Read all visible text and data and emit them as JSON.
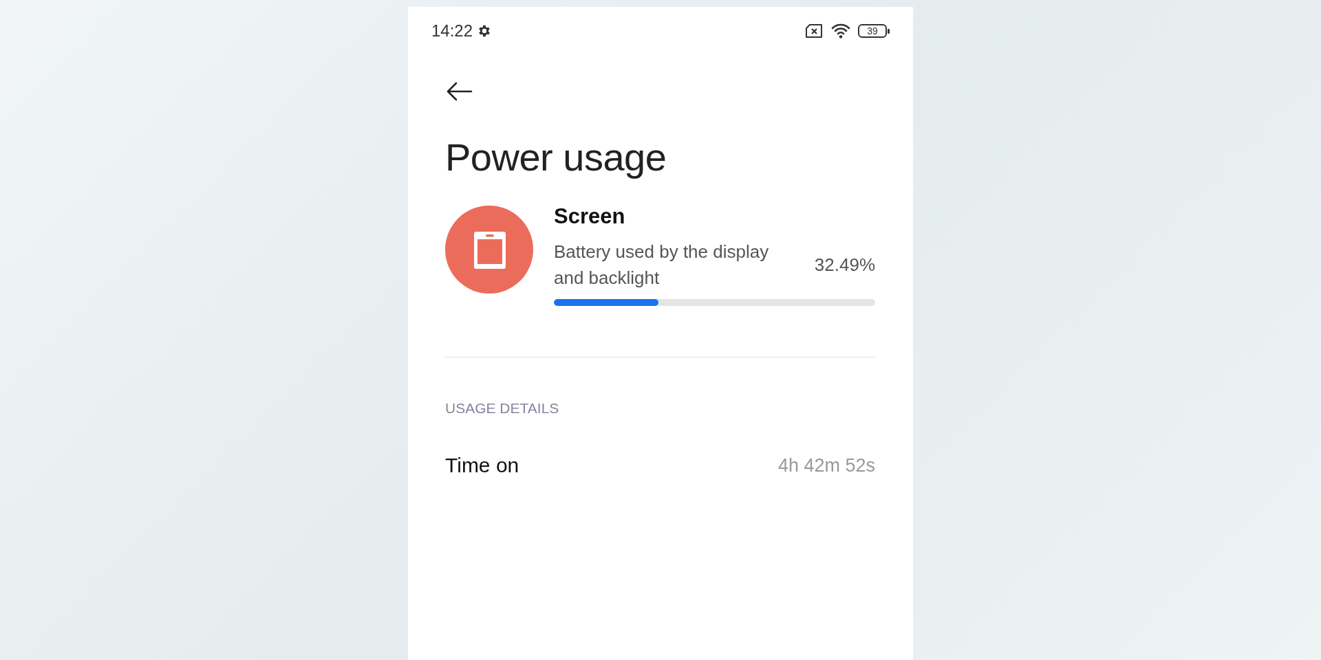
{
  "status_bar": {
    "time": "14:22",
    "battery": "39"
  },
  "title": "Power usage",
  "usage_item": {
    "name": "Screen",
    "description": "Battery used by the display and backlight",
    "percent": "32.49%",
    "level": 0.3249
  },
  "section_header": "USAGE DETAILS",
  "details": [
    {
      "label": "Time on",
      "value": "4h 42m 52s"
    }
  ]
}
